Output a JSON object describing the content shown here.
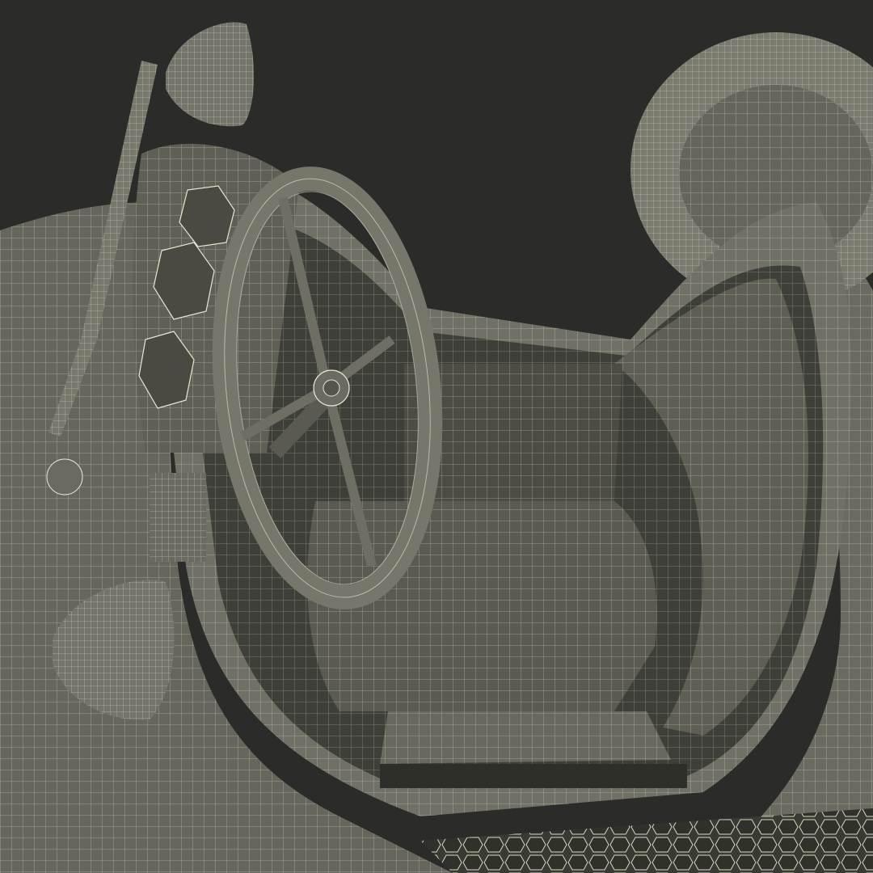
{
  "scene": {
    "subject": "",
    "colors": {
      "background": "#2b2b2a",
      "body": "#66665c",
      "body_dark": "#4e4e47",
      "body_light": "#7a7a6f",
      "cockpit": "#3f3f3a",
      "seat": "#58584f",
      "wire": "#e9e6cf"
    }
  }
}
